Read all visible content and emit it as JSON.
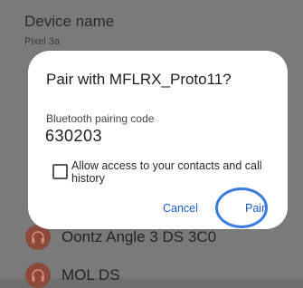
{
  "background": {
    "title": "Device name",
    "subtitle": "Pixel 3a",
    "devices": [
      {
        "name": "Oontz Angle 3 DS 3C0",
        "icon": "headphones-icon"
      },
      {
        "name": "MOL DS",
        "icon": "headphones-icon"
      }
    ]
  },
  "dialog": {
    "title": "Pair with MFLRX_Proto11?",
    "code_label": "Bluetooth pairing code",
    "code": "630203",
    "checkbox_label": "Allow access to your contacts and call history",
    "checkbox_checked": false,
    "cancel_label": "Cancel",
    "pair_label": "Pair"
  },
  "colors": {
    "accent": "#1a5fd0",
    "highlight_ring": "#3a7be0"
  }
}
